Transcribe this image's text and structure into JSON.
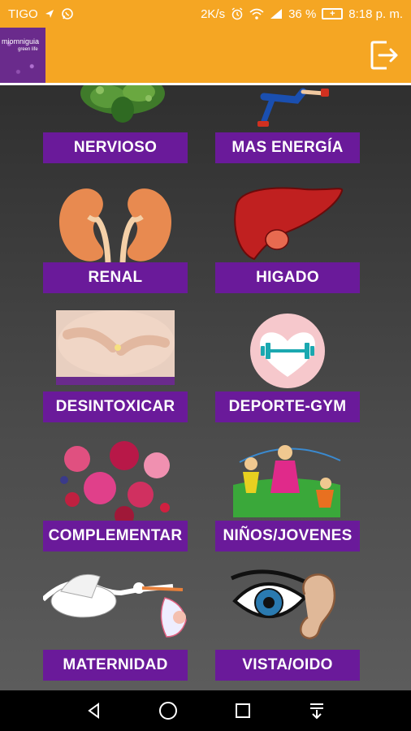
{
  "status_bar": {
    "carrier": "TIGO",
    "speed": "2K/s",
    "battery_percent": "36 %",
    "battery_level": 36,
    "time": "8:18 p. m.",
    "icons": [
      "location-arrow-icon",
      "whatsapp-icon",
      "alarm-icon",
      "wifi-icon",
      "signal-icon",
      "battery-charging-icon"
    ]
  },
  "app_bar": {
    "logo_text": "miomniguia",
    "logo_subtext": "green life",
    "exit_icon": "exit-icon"
  },
  "tiles": [
    {
      "label": "NERVIOSO",
      "icon": "herbs-icon"
    },
    {
      "label": "MAS ENERGÍA",
      "icon": "runner-icon"
    },
    {
      "label": "RENAL",
      "icon": "kidneys-icon"
    },
    {
      "label": "HIGADO",
      "icon": "liver-icon"
    },
    {
      "label": "DESINTOXICAR",
      "icon": "belly-hands-icon"
    },
    {
      "label": "DEPORTE-GYM",
      "icon": "dumbbell-heart-icon"
    },
    {
      "label": "COMPLEMENTAR",
      "icon": "smoothies-icon"
    },
    {
      "label": "NIÑOS/JOVENES",
      "icon": "kids-playing-icon"
    },
    {
      "label": "MATERNIDAD",
      "icon": "stork-baby-icon"
    },
    {
      "label": "VISTA/OIDO",
      "icon": "eye-ear-icon"
    }
  ],
  "colors": {
    "accent": "#f5a623",
    "button": "#6a1a9a",
    "logo": "#6a2b8c"
  },
  "nav_bar": {
    "icons": [
      "back-icon",
      "home-icon",
      "recents-icon",
      "notification-pull-icon"
    ]
  }
}
